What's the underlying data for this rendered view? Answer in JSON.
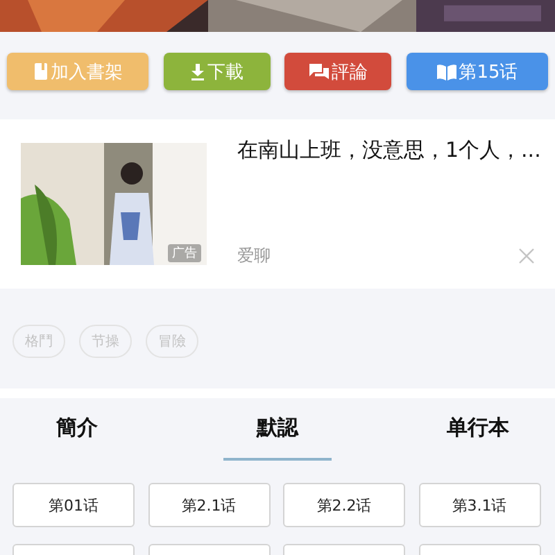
{
  "banner": {
    "kind": "picture"
  },
  "actions": [
    {
      "kind": "shelf",
      "label": "加入書架"
    },
    {
      "kind": "download",
      "label": "下載"
    },
    {
      "kind": "comment",
      "label": "評論"
    },
    {
      "kind": "read",
      "label": "第15话"
    }
  ],
  "ad": {
    "picture": {
      "kind": "picture"
    },
    "badge": "广告",
    "title": "在南山上班，没意思，1个人，...",
    "source": "爱聊"
  },
  "tags": [
    "格鬥",
    "节操",
    "冒險"
  ],
  "tabs": [
    {
      "label": "簡介",
      "selected": false
    },
    {
      "label": "默認",
      "selected": true
    },
    {
      "label": "单行本",
      "selected": false
    }
  ],
  "chapters": [
    "第01话",
    "第2.1话",
    "第2.2话",
    "第3.1话"
  ]
}
